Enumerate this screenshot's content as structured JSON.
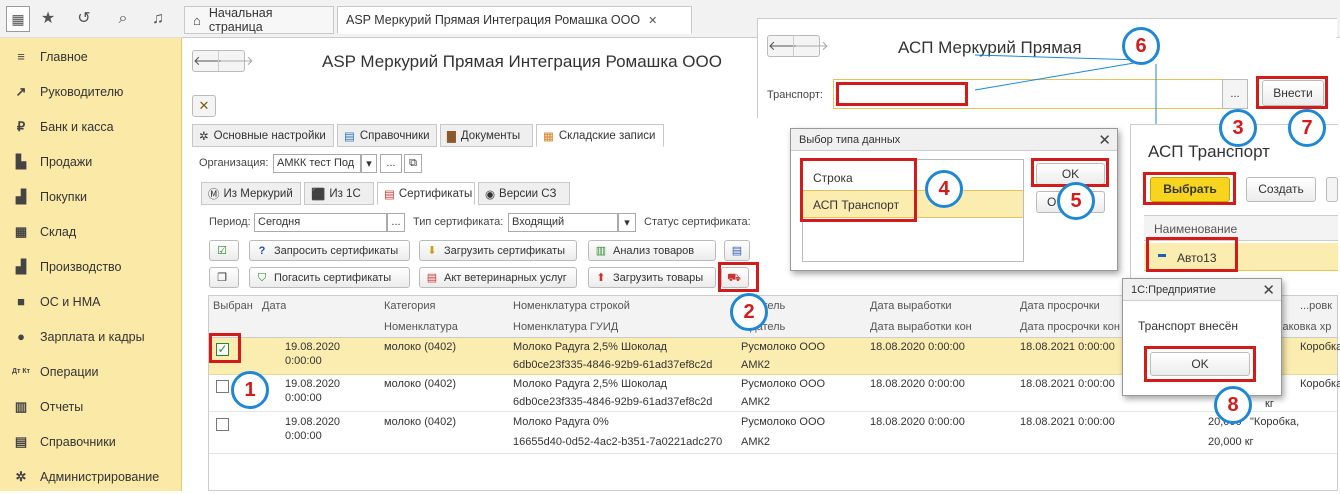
{
  "sidebar": {
    "items": [
      {
        "label": "Главное",
        "icon": "menu-icon"
      },
      {
        "label": "Руководителю",
        "icon": "trend-icon"
      },
      {
        "label": "Банк и касса",
        "icon": "ruble-icon"
      },
      {
        "label": "Продажи",
        "icon": "bag-icon"
      },
      {
        "label": "Покупки",
        "icon": "cart-icon"
      },
      {
        "label": "Склад",
        "icon": "grid-icon"
      },
      {
        "label": "Производство",
        "icon": "factory-icon"
      },
      {
        "label": "ОС и НМА",
        "icon": "truck-icon"
      },
      {
        "label": "Зарплата и кадры",
        "icon": "people-icon"
      },
      {
        "label": "Операции",
        "icon": "dtkt-icon"
      },
      {
        "label": "Отчеты",
        "icon": "chart-icon"
      },
      {
        "label": "Справочники",
        "icon": "book-icon"
      },
      {
        "label": "Администрирование",
        "icon": "gear-icon"
      }
    ],
    "dtkt_glyph": "Дт Кт"
  },
  "tabs": {
    "home": "Начальная страница",
    "doc": "ASP Меркурий Прямая Интеграция Ромашка ООО",
    "close_glyph": "✕"
  },
  "form": {
    "title": "ASP Меркурий Прямая Интеграция Ромашка ООО",
    "tabs": [
      "Основные настройки",
      "Справочники",
      "Документы",
      "Складские записи"
    ],
    "org_label": "Организация:",
    "org_value": "АМКК тест Под",
    "subtabs": [
      "Из Меркурий",
      "Из 1С",
      "Сертификаты",
      "Версии СЗ"
    ],
    "period_label": "Период:",
    "period_value": "Сегодня",
    "cert_type_label": "Тип сертификата:",
    "cert_type_value": "Входящий",
    "cert_status_label": "Статус сертификата:",
    "dots": "...",
    "buttons": {
      "request": "Запросить сертификаты",
      "load_certs": "Загрузить сертификаты",
      "analyze": "Анализ товаров",
      "repay": "Погасить сертификаты",
      "vet_act": "Акт ветеринарных услуг",
      "load_goods": "Загрузить товары"
    },
    "table": {
      "headers1": [
        "Выбран",
        "Дата",
        "Категория",
        "Номенклатура строкой",
        "...ритель",
        "Дата выработки",
        "Дата просрочки",
        "...ровк"
      ],
      "headers2": [
        "Номенклатура",
        "Номенклатура ГУИД",
        "...датель",
        "Дата выработки кон",
        "Дата просрочки кон",
        "Упаковка хр"
      ],
      "rows": [
        {
          "date": "19.08.2020",
          "time": "0:00:00",
          "cat": "молоко (0402)",
          "nom": "Молоко Радуга 2,5% Шоколад",
          "guid": "6db0ce23f335-4846-92b9-61ad37ef8c2d",
          "sender": "Русмолоко ООО",
          "sender2": "АМК2",
          "prod": "18.08.2020 0:00:00",
          "exp": "18.08.2021 0:00:00",
          "pack": "Коробка,",
          "checked": true
        },
        {
          "date": "19.08.2020",
          "time": "0:00:00",
          "cat": "молоко (0402)",
          "nom": "Молоко Радуга 2,5% Шоколад",
          "guid": "6db0ce23f335-4846-92b9-61ad37ef8c2d",
          "sender": "Русмолоко ООО",
          "sender2": "АМК2",
          "prod": "18.08.2020 0:00:00",
          "exp": "18.08.2021 0:00:00",
          "pack": "Коробка,",
          "qty": "кг",
          "checked": false
        },
        {
          "date": "19.08.2020",
          "time": "0:00:00",
          "cat": "молоко (0402)",
          "nom": "Молоко Радуга 0%",
          "guid": "16655d40-0d52-4ac2-b351-7a0221adc270",
          "sender": "Русмолоко ООО",
          "sender2": "АМК2",
          "prod": "18.08.2020 0:00:00",
          "exp": "18.08.2021 0:00:00",
          "pack": "\"Коробка,",
          "qty": "20,000",
          "qty2": "20,000  кг",
          "checked": false
        }
      ]
    }
  },
  "asp_window": {
    "title": "АСП Меркурий Прямая",
    "transport_label": "Транспорт:",
    "dots": "...",
    "apply": "Внести"
  },
  "type_dialog": {
    "title": "Выбор типа данных",
    "items": [
      "Строка",
      "АСП Транспорт"
    ],
    "ok": "OK",
    "cancel_partial": "О"
  },
  "transport_window": {
    "title": "АСП Транспорт",
    "select": "Выбрать",
    "create": "Создать",
    "column": "Наименование",
    "item": "Авто13"
  },
  "msg_dialog": {
    "title": "1С:Предприятие",
    "text": "Транспорт внесён",
    "ok": "OK"
  },
  "callouts": [
    "1",
    "2",
    "3",
    "4",
    "5",
    "6",
    "7",
    "8"
  ],
  "colors": {
    "sidebar": "#fbe9a7",
    "highlight": "#fbecb0",
    "callout_border": "#1e88d4",
    "callout_text": "#d21c1c",
    "select_button": "#f7d51e"
  }
}
